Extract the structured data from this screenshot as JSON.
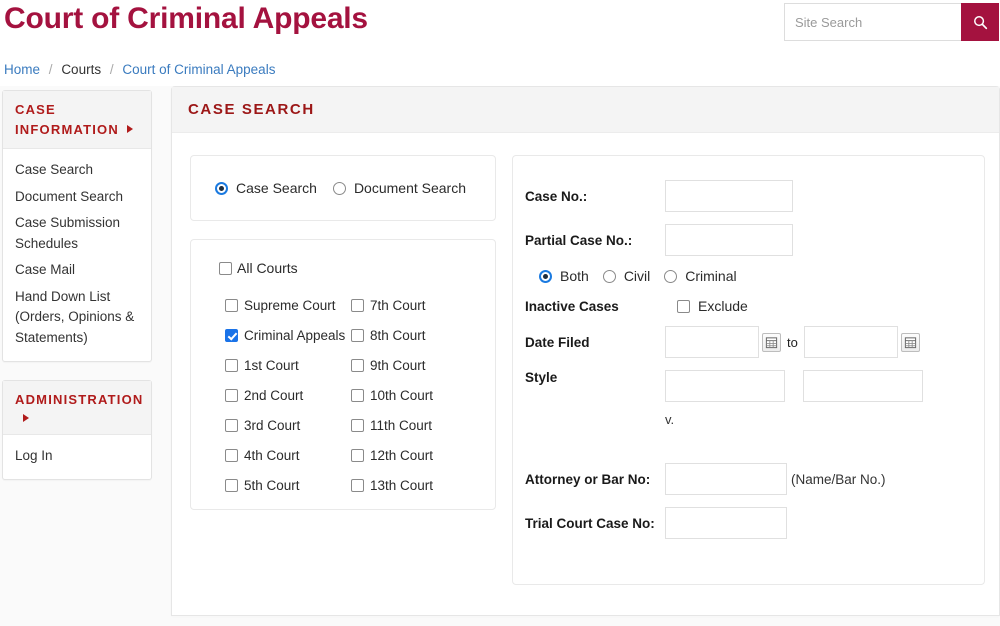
{
  "header": {
    "site_title": "Court of Criminal Appeals",
    "search_placeholder": "Site Search",
    "search_value": "",
    "search_icon": "search-icon",
    "brand_color": "#a4123f"
  },
  "breadcrumb": {
    "items": [
      {
        "label": "Home",
        "link": true
      },
      {
        "label": "Courts",
        "link": false
      },
      {
        "label": "Court of Criminal Appeals",
        "link": true
      }
    ],
    "separator": "/"
  },
  "sidebar": {
    "sections": [
      {
        "title": "CASE INFORMATION",
        "arrow_icon": "triangle-right-icon",
        "items": [
          {
            "label": "Case Search"
          },
          {
            "label": "Document Search"
          },
          {
            "label": "Case Submission Schedules"
          },
          {
            "label": "Case Mail"
          },
          {
            "label": "Hand Down List (Orders, Opinions & Statements)"
          }
        ]
      },
      {
        "title": "ADMINISTRATION",
        "arrow_icon": "triangle-right-icon",
        "items": [
          {
            "label": "Log In"
          }
        ]
      }
    ]
  },
  "main": {
    "heading": "CASE SEARCH",
    "search_mode": {
      "options": [
        {
          "label": "Case Search",
          "selected": true
        },
        {
          "label": "Document Search",
          "selected": false
        }
      ]
    },
    "courts": {
      "all_courts": {
        "label": "All Courts",
        "checked": false
      },
      "column_left": [
        {
          "label": "Supreme Court",
          "checked": false
        },
        {
          "label": "Criminal Appeals",
          "checked": true
        },
        {
          "label": "1st Court",
          "checked": false
        },
        {
          "label": "2nd Court",
          "checked": false
        },
        {
          "label": "3rd Court",
          "checked": false
        },
        {
          "label": "4th Court",
          "checked": false
        },
        {
          "label": "5th Court",
          "checked": false
        }
      ],
      "column_right": [
        {
          "label": "7th Court",
          "checked": false
        },
        {
          "label": "8th Court",
          "checked": false
        },
        {
          "label": "9th Court",
          "checked": false
        },
        {
          "label": "10th Court",
          "checked": false
        },
        {
          "label": "11th Court",
          "checked": false
        },
        {
          "label": "12th Court",
          "checked": false
        },
        {
          "label": "13th Court",
          "checked": false
        }
      ]
    },
    "fields": {
      "case_no_label": "Case No.:",
      "case_no_value": "",
      "partial_case_no_label": "Partial Case No.:",
      "partial_case_no_value": "",
      "case_type": {
        "options": [
          {
            "label": "Both",
            "selected": true
          },
          {
            "label": "Civil",
            "selected": false
          },
          {
            "label": "Criminal",
            "selected": false
          }
        ]
      },
      "inactive_label": "Inactive Cases",
      "exclude_label": "Exclude",
      "exclude_checked": false,
      "date_filed_label": "Date Filed",
      "date_from_value": "",
      "date_to_value": "",
      "date_to_word": "to",
      "calendar_icon": "calendar-icon",
      "style_label": "Style",
      "style_value_1": "",
      "style_value_2": "",
      "versus_text": "v.",
      "attorney_label": "Attorney or Bar No:",
      "attorney_value": "",
      "attorney_hint": "(Name/Bar No.)",
      "trial_court_label": "Trial Court Case No:",
      "trial_court_value": ""
    }
  }
}
